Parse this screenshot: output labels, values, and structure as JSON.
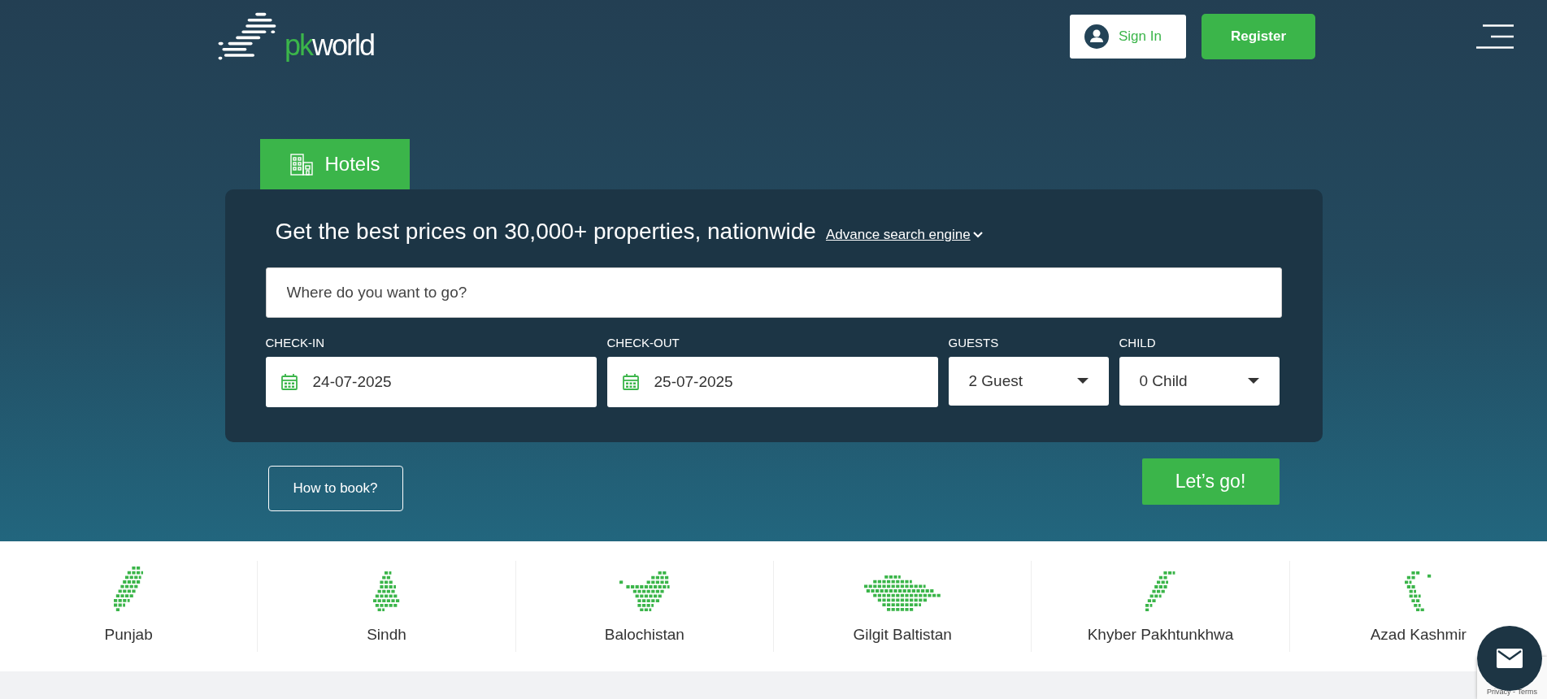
{
  "header": {
    "logo": {
      "part_1": "pk",
      "part_2": "world"
    },
    "sign_in": "Sign In",
    "register": "Register"
  },
  "tabs": [
    {
      "label": "Hotels",
      "selected": true
    }
  ],
  "search": {
    "heading": "Get the best prices on 30,000+ properties, nationwide",
    "advance_link": "Advance search engine",
    "destination": {
      "placeholder": "Where do you want to go?"
    },
    "fields": [
      {
        "kind": "date",
        "label": "CHECK-IN",
        "value": "24-07-2025"
      },
      {
        "kind": "date",
        "label": "CHECK-OUT",
        "value": "25-07-2025"
      },
      {
        "kind": "select",
        "label": "GUESTS",
        "value": "2 Guest"
      },
      {
        "kind": "select",
        "label": "CHILD",
        "value": "0 Child"
      }
    ],
    "how_to_book": "How to book?",
    "submit": "Let’s go!"
  },
  "regions": [
    {
      "name": "Punjab"
    },
    {
      "name": "Sindh"
    },
    {
      "name": "Balochistan"
    },
    {
      "name": "Gilgit Baltistan"
    },
    {
      "name": "Khyber Pakhtunkhwa"
    },
    {
      "name": "Azad Kashmir"
    }
  ],
  "recaptcha": {
    "text": "Privacy - Terms"
  }
}
